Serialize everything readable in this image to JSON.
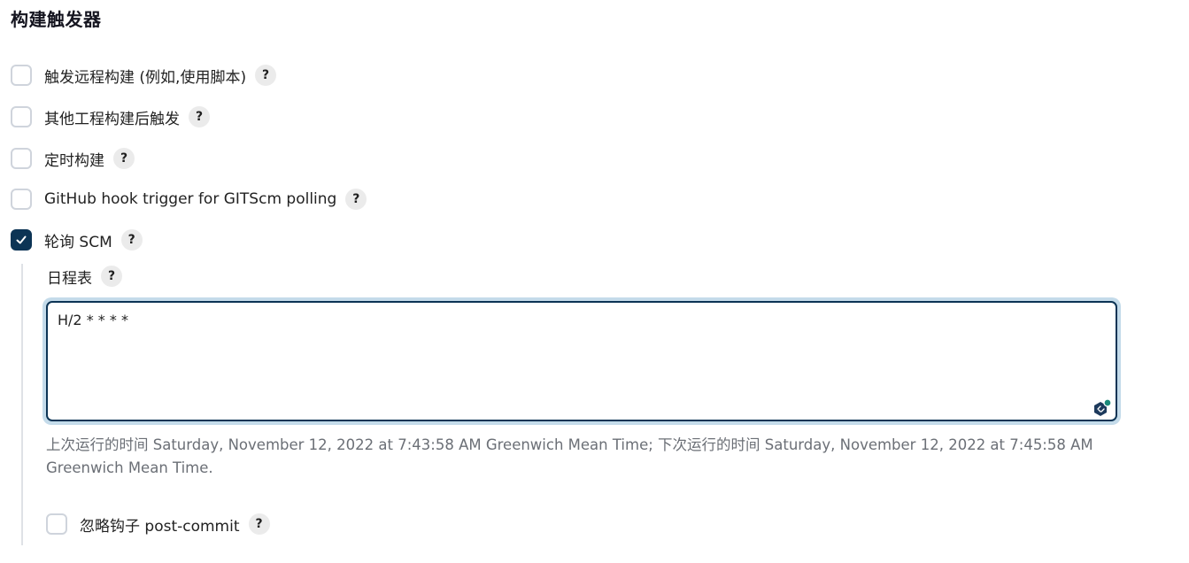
{
  "section": {
    "title": "构建触发器"
  },
  "triggers": [
    {
      "label": "触发远程构建 (例如,使用脚本)",
      "checked": false
    },
    {
      "label": "其他工程构建后触发",
      "checked": false
    },
    {
      "label": "定时构建",
      "checked": false
    },
    {
      "label": "GitHub hook trigger for GITScm polling",
      "checked": false
    },
    {
      "label": "轮询 SCM",
      "checked": true
    }
  ],
  "help_mark": "?",
  "poll_scm": {
    "schedule_label": "日程表",
    "schedule_value": "H/2 * * * *",
    "info_text": "上次运行的时间 Saturday, November 12, 2022 at 7:43:58 AM Greenwich Mean Time; 下次运行的时间 Saturday, November 12, 2022 at 7:45:58 AM Greenwich Mean Time.",
    "ignore_hook_label": "忽略钩子 post-commit",
    "ignore_hook_checked": false
  },
  "colors": {
    "accent": "#0c3455",
    "focus_ring": "#c4dbea",
    "muted_text": "#6b6f76"
  }
}
